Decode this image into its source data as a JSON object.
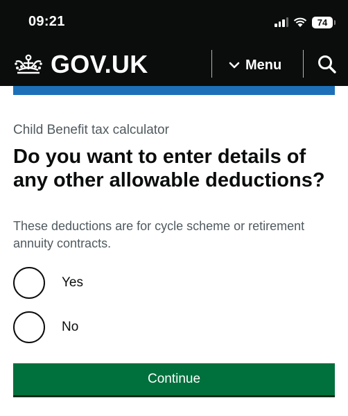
{
  "status_bar": {
    "time": "09:21",
    "battery": "74"
  },
  "header": {
    "logo_text": "GOV.UK",
    "menu_label": "Menu"
  },
  "page": {
    "caption": "Child Benefit tax calculator",
    "heading": "Do you want to enter details of any other allowable deductions?",
    "hint": "These deductions are for cycle scheme or retirement annuity contracts.",
    "options": [
      {
        "label": "Yes"
      },
      {
        "label": "No"
      }
    ],
    "continue_label": "Continue"
  },
  "colors": {
    "header_bg": "#0b0c0c",
    "accent_blue": "#1d70b8",
    "button_green": "#00703c",
    "secondary_text": "#505a5f"
  },
  "icons": [
    "wifi-icon",
    "cellular-signal-icon",
    "crown-icon",
    "chevron-down-icon",
    "search-icon"
  ]
}
